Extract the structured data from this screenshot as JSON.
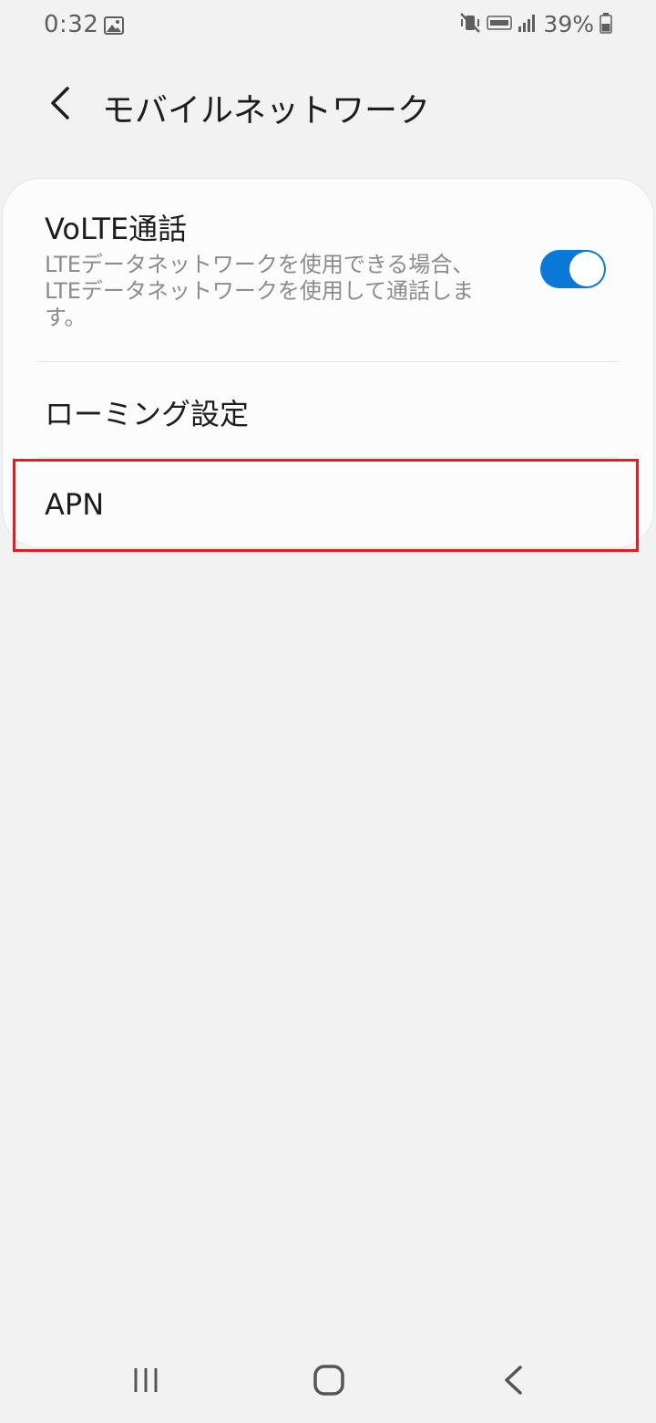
{
  "status_bar": {
    "time": "0:32",
    "battery_percent": "39%",
    "icons": [
      "gallery-icon",
      "mute-vibrate-icon",
      "volte-icon",
      "signal-icon",
      "battery-icon"
    ]
  },
  "header": {
    "title": "モバイルネットワーク",
    "back_icon": "chevron-left-icon"
  },
  "settings": {
    "volte": {
      "title": "VoLTE通話",
      "description": "LTEデータネットワークを使用できる場合、LTEデータネットワークを使用して通話します。",
      "toggle_on": true
    },
    "roaming": {
      "label": "ローミング設定"
    },
    "apn": {
      "label": "APN"
    }
  },
  "colors": {
    "background": "#f2f2f2",
    "card": "#fcfcfc",
    "accent": "#0a78d7",
    "highlight": "#e01e26"
  },
  "nav_bar": {
    "icons": [
      "recents-icon",
      "home-icon",
      "back-icon"
    ]
  }
}
